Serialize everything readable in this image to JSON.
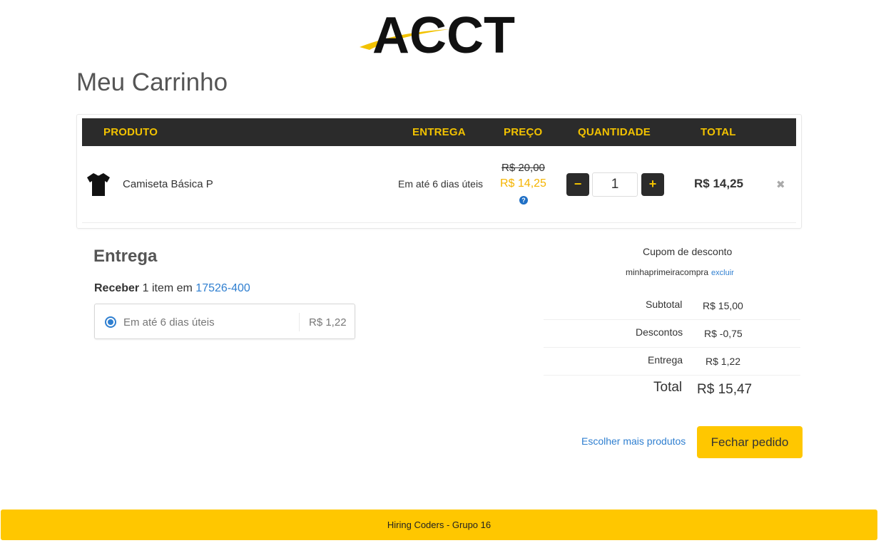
{
  "brand": {
    "logo_text": "ACCT",
    "accent_color": "#ffc700",
    "dark_color": "#2b2b2b"
  },
  "page": {
    "title": "Meu Carrinho"
  },
  "cart": {
    "headers": {
      "product": "PRODUTO",
      "delivery": "ENTREGA",
      "price": "PREÇO",
      "quantity": "QUANTIDADE",
      "total": "TOTAL"
    },
    "items": [
      {
        "image_icon": "tshirt-icon",
        "name": "Camiseta Básica P",
        "delivery": "Em até 6 dias úteis",
        "price_old": "R$ 20,00",
        "price_new": "R$ 14,25",
        "quantity": "1",
        "total": "R$ 14,25",
        "decrease_label": "−",
        "increase_label": "+",
        "remove_label": "✖",
        "help_label": "?"
      }
    ]
  },
  "shipping": {
    "title": "Entrega",
    "receive_prefix": "Receber",
    "receive_middle": " 1 item em ",
    "zip": "17526-400",
    "option": {
      "label": "Em até 6 dias úteis",
      "price": "R$ 1,22",
      "selected": true
    }
  },
  "coupon": {
    "title": "Cupom de desconto",
    "code": "minhaprimeiracompra",
    "remove_label": "excluir"
  },
  "summary": {
    "subtotal_label": "Subtotal",
    "subtotal_value": "R$ 15,00",
    "discount_label": "Descontos",
    "discount_value": "R$ -0,75",
    "shipping_label": "Entrega",
    "shipping_value": "R$ 1,22",
    "total_label": "Total",
    "total_value": "R$ 15,47"
  },
  "actions": {
    "more_products": "Escolher mais produtos",
    "checkout": "Fechar pedido"
  },
  "footer": {
    "text": "Hiring Coders - Grupo 16"
  }
}
